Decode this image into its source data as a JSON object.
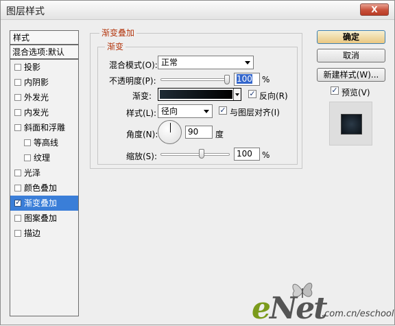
{
  "window": {
    "title": "图层样式",
    "close_label": "X"
  },
  "style_list": {
    "header": "样式",
    "blend_options": "混合选项:默认",
    "items": [
      {
        "label": "投影",
        "checked": false,
        "indent": false
      },
      {
        "label": "内阴影",
        "checked": false,
        "indent": false
      },
      {
        "label": "外发光",
        "checked": false,
        "indent": false
      },
      {
        "label": "内发光",
        "checked": false,
        "indent": false
      },
      {
        "label": "斜面和浮雕",
        "checked": false,
        "indent": false
      },
      {
        "label": "等高线",
        "checked": false,
        "indent": true
      },
      {
        "label": "纹理",
        "checked": false,
        "indent": true
      },
      {
        "label": "光泽",
        "checked": false,
        "indent": false
      },
      {
        "label": "颜色叠加",
        "checked": false,
        "indent": false
      },
      {
        "label": "渐变叠加",
        "checked": true,
        "indent": false,
        "selected": true
      },
      {
        "label": "图案叠加",
        "checked": false,
        "indent": false
      },
      {
        "label": "描边",
        "checked": false,
        "indent": false
      }
    ]
  },
  "gradient_overlay": {
    "group_title": "渐变叠加",
    "sub_title": "渐变",
    "blend_mode_label": "混合模式(O):",
    "blend_mode_value": "正常",
    "opacity_label": "不透明度(P):",
    "opacity_value": "100",
    "opacity_unit": "%",
    "gradient_label": "渐变:",
    "reverse_label": "反向(R)",
    "reverse_checked": true,
    "style_label": "样式(L):",
    "style_value": "径向",
    "align_label": "与图层对齐(I)",
    "align_checked": true,
    "angle_label": "角度(N):",
    "angle_value": "90",
    "angle_unit": "度",
    "scale_label": "缩放(S):",
    "scale_value": "100",
    "scale_unit": "%",
    "opacity_fraction": 1.0,
    "scale_fraction": 0.6
  },
  "buttons": {
    "ok": "确定",
    "cancel": "取消",
    "new_style": "新建样式(W)...",
    "preview_label": "预览(V)",
    "preview_checked": true
  },
  "watermark": {
    "logo": "eNet",
    "suffix": ".com.cn/eschool"
  }
}
